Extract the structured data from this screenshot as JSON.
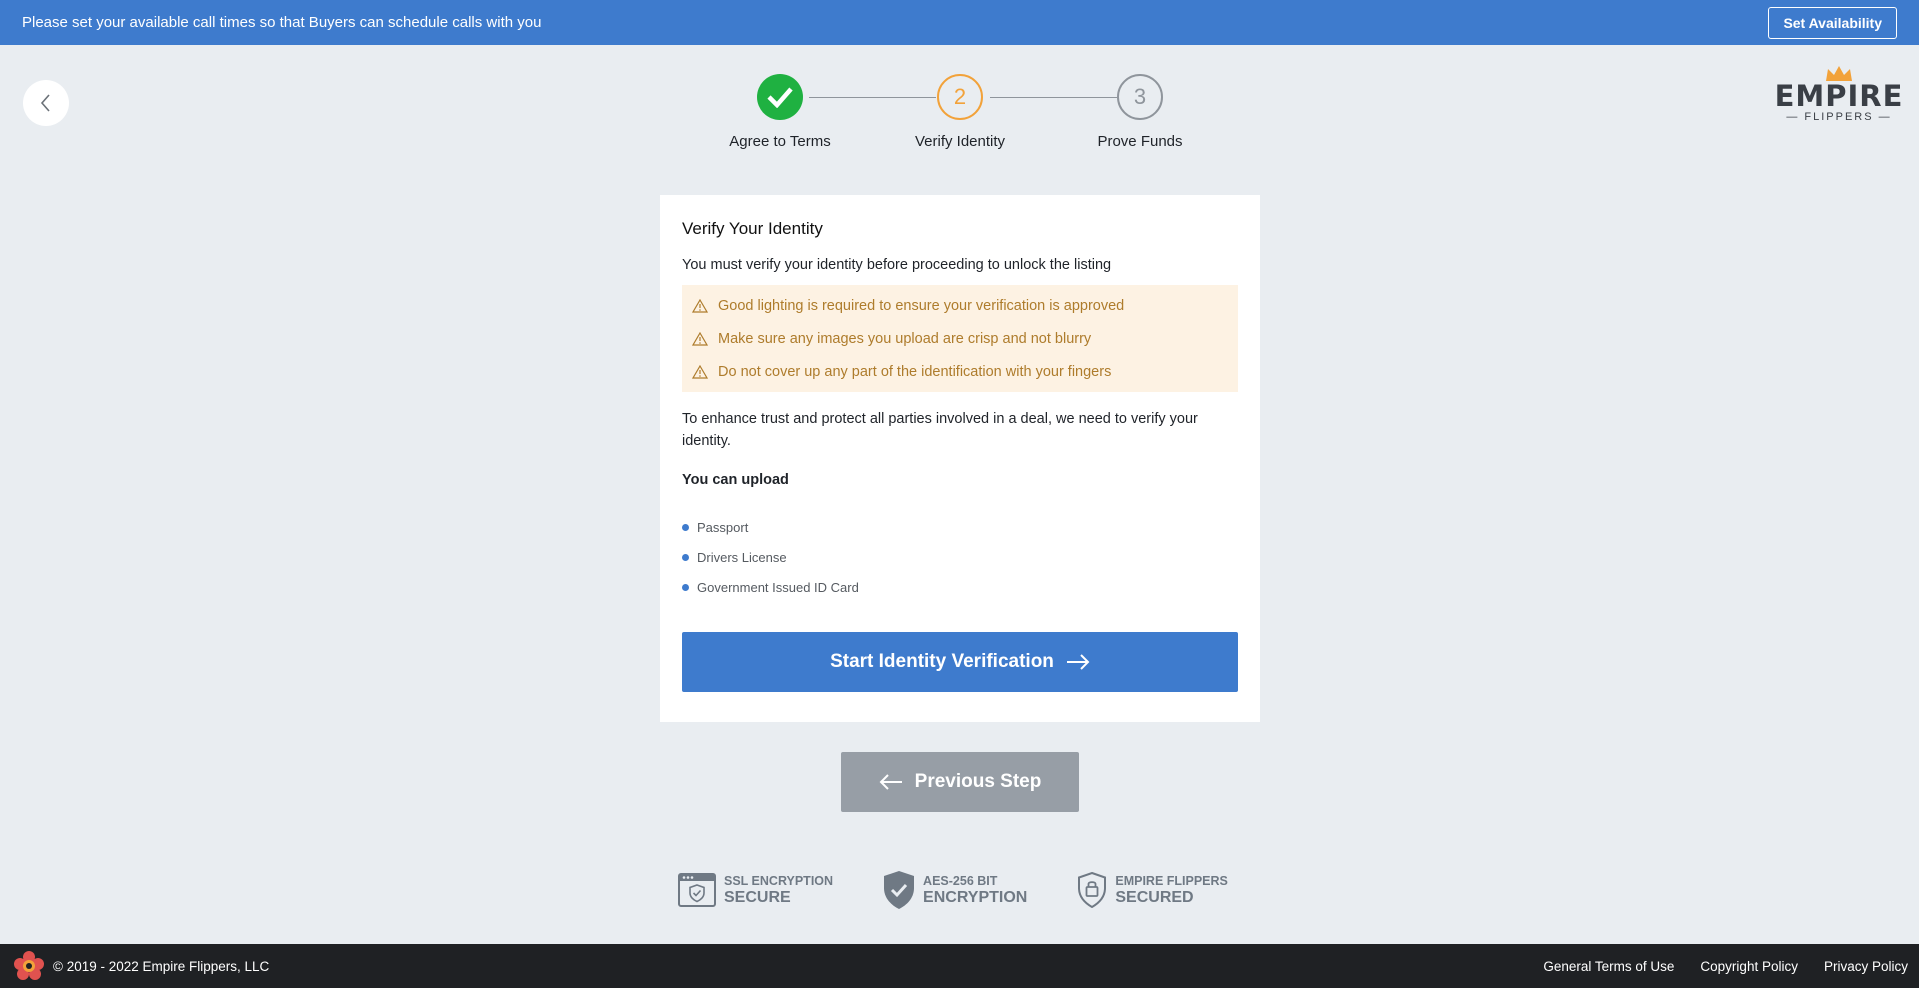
{
  "banner": {
    "message": "Please set your available call times so that Buyers can schedule calls with you",
    "button_label": "Set Availability"
  },
  "logo": {
    "word": "EMPIRE",
    "sub": "— FLIPPERS —"
  },
  "stepper": {
    "steps": [
      {
        "number": "1",
        "label": "Agree to Terms",
        "state": "done"
      },
      {
        "number": "2",
        "label": "Verify Identity",
        "state": "active"
      },
      {
        "number": "3",
        "label": "Prove Funds",
        "state": "todo"
      }
    ]
  },
  "card": {
    "title": "Verify Your Identity",
    "intro": "You must verify your identity before proceeding to unlock the listing",
    "warnings": [
      "Good lighting is required to ensure your verification is approved",
      "Make sure any images you upload are crisp and not blurry",
      "Do not cover up any part of the identification with your fingers"
    ],
    "description": "To enhance trust and protect all parties involved in a deal, we need to verify your identity.",
    "upload_title": "You can upload",
    "upload_items": [
      "Passport",
      "Drivers License",
      "Government Issued ID Card"
    ],
    "start_button": "Start Identity Verification"
  },
  "previous_button": "Previous Step",
  "badges": [
    {
      "line1": "SSL ENCRYPTION",
      "line2": "SECURE",
      "icon": "browser-shield-icon"
    },
    {
      "line1": "AES-256 BIT",
      "line2": "ENCRYPTION",
      "icon": "shield-check-icon"
    },
    {
      "line1": "EMPIRE FLIPPERS",
      "line2": "SECURED",
      "icon": "lock-shield-icon"
    }
  ],
  "footer": {
    "copyright": "© 2019 - 2022 Empire Flippers, LLC",
    "links": [
      "General Terms of Use",
      "Copyright Policy",
      "Privacy Policy"
    ]
  },
  "colors": {
    "primary": "#3e7bcd",
    "success": "#1fb141",
    "active_step": "#f2a23a",
    "warning_bg": "#fdf2e3",
    "warning_text": "#ae7c2c",
    "footer_bg": "#1f2124",
    "page_bg": "#e9edf1"
  }
}
